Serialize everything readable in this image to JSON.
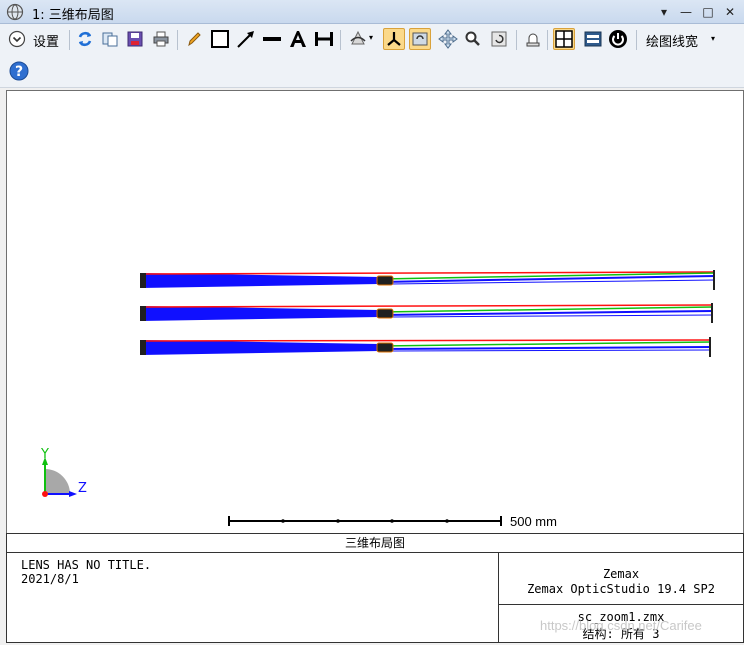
{
  "window": {
    "title": "1: 三维布局图",
    "pin_icon": "pin-down-arrow-icon",
    "minimize_glyph": "—",
    "maximize_glyph": "□",
    "close_glyph": "✕"
  },
  "toolbar": {
    "settings_label": "设置",
    "line_width_label": "绘图线宽"
  },
  "plot": {
    "axis_y_label": "Y",
    "axis_z_label": "Z",
    "scale_label": "500 mm",
    "colors": {
      "ray_blue": "#1010ff",
      "ray_green": "#10c010",
      "ray_red": "#ff1010",
      "lens": "#202020"
    }
  },
  "caption": {
    "text": "三维布局图"
  },
  "info": {
    "lens_title": "LENS HAS NO TITLE.",
    "date": "2021/8/1",
    "company": "Zemax",
    "software": "Zemax OpticStudio 19.4 SP2",
    "file": "sc_zoom1.zmx",
    "config": "结构: 所有 3"
  },
  "watermark": {
    "text": "https://blog.csdn.net/Carifee"
  }
}
